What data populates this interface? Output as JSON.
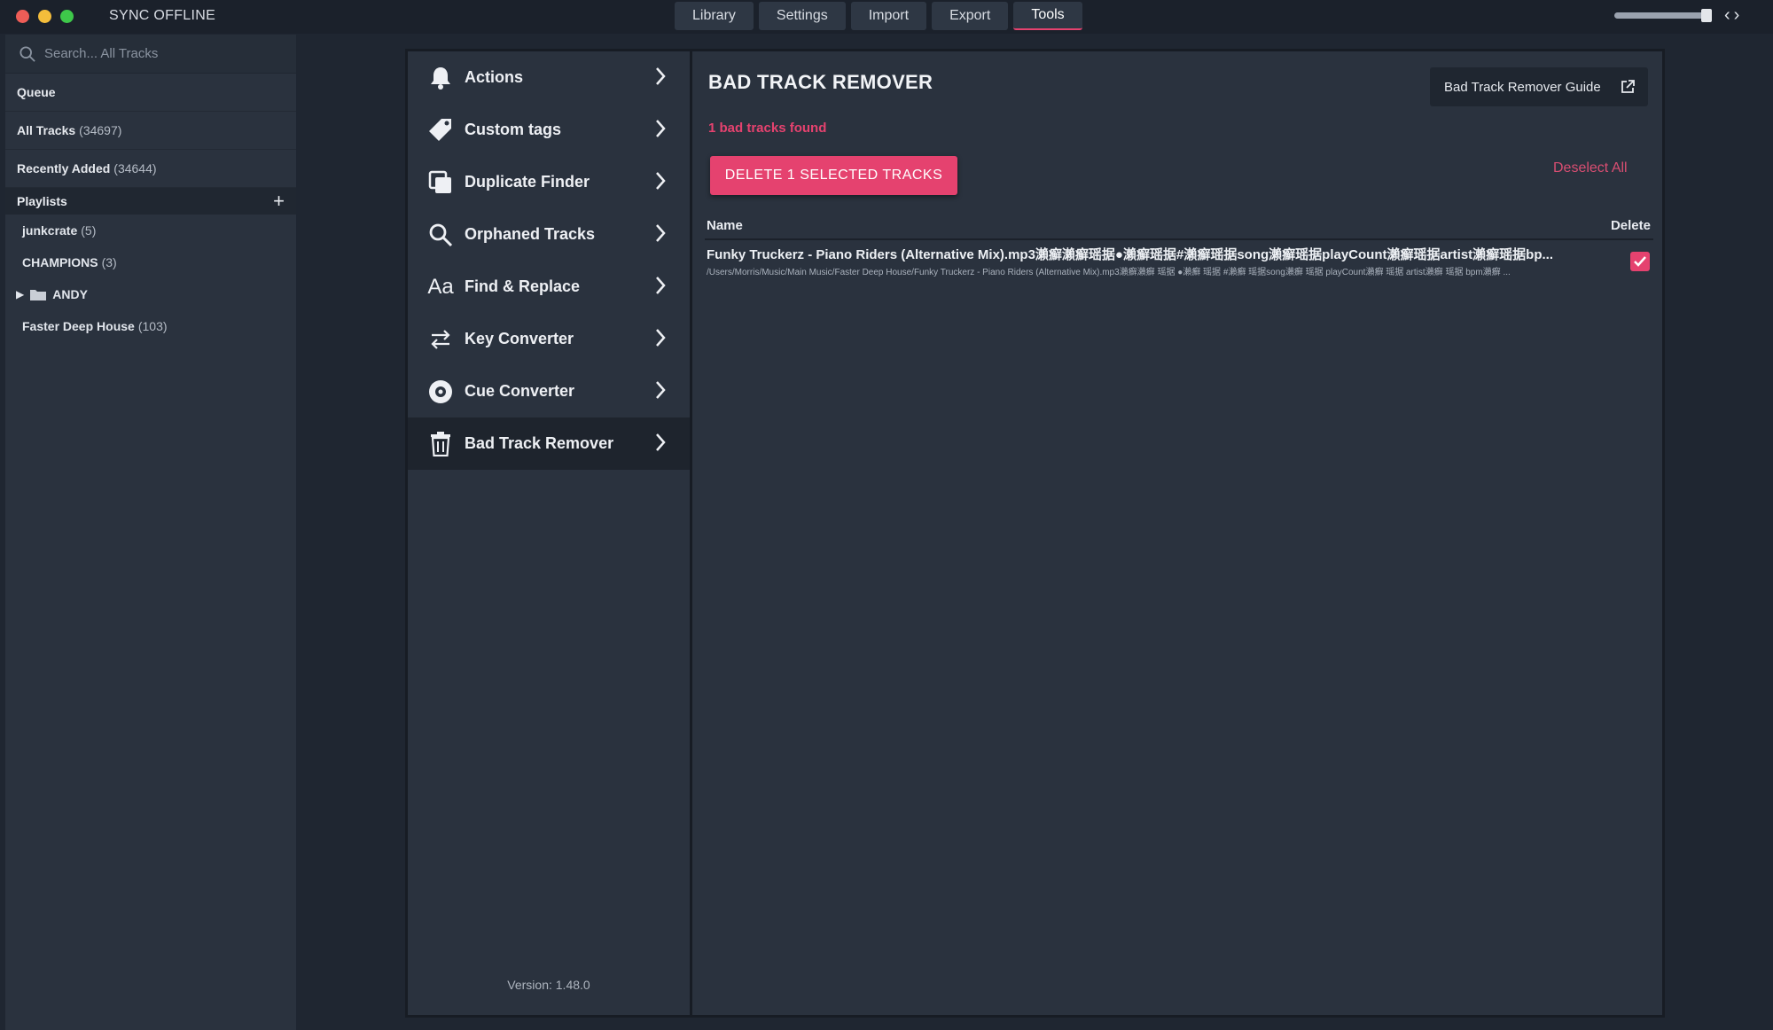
{
  "app": {
    "status": "SYNC OFFLINE"
  },
  "topnav": {
    "tabs": [
      {
        "label": "Library"
      },
      {
        "label": "Settings"
      },
      {
        "label": "Import"
      },
      {
        "label": "Export"
      },
      {
        "label": "Tools",
        "active": true
      }
    ]
  },
  "sidebar": {
    "search_placeholder": "Search... All Tracks",
    "items": [
      {
        "label": "Queue",
        "count": ""
      },
      {
        "label": "All Tracks",
        "count": "(34697)"
      },
      {
        "label": "Recently Added",
        "count": "(34644)"
      }
    ],
    "playlists_label": "Playlists",
    "playlists": [
      {
        "label": "junkcrate",
        "count": "(5)"
      },
      {
        "label": "CHAMPIONS",
        "count": "(3)"
      },
      {
        "label": "ANDY",
        "count": ""
      },
      {
        "label": "Faster Deep House",
        "count": "(103)"
      }
    ]
  },
  "tools": {
    "items": [
      {
        "label": "Actions",
        "icon": "bell-icon"
      },
      {
        "label": "Custom tags",
        "icon": "tag-icon"
      },
      {
        "label": "Duplicate Finder",
        "icon": "copy-icon"
      },
      {
        "label": "Orphaned Tracks",
        "icon": "search-icon"
      },
      {
        "label": "Find & Replace",
        "icon": "text-icon"
      },
      {
        "label": "Key Converter",
        "icon": "swap-arrows-icon"
      },
      {
        "label": "Cue Converter",
        "icon": "disc-icon"
      },
      {
        "label": "Bad Track Remover",
        "icon": "trash-icon",
        "active": true
      }
    ],
    "version": "Version: 1.48.0"
  },
  "content": {
    "title": "BAD TRACK REMOVER",
    "guide_label": "Bad Track Remover Guide",
    "found_text": "1 bad tracks found",
    "delete_label": "DELETE 1 SELECTED TRACKS",
    "deselect_label": "Deselect All",
    "col_name": "Name",
    "col_delete": "Delete",
    "rows": [
      {
        "title": "Funky Truckerz - Piano Riders (Alternative Mix).mp3瀨癬瀨癬瑶据●瀨癬瑶据#瀨癬瑶据song瀨癬瑶据playCount瀨癬瑶据artist瀨癬瑶据bp...",
        "path": "/Users/Morris/Music/Main Music/Faster Deep House/Funky Truckerz - Piano Riders (Alternative Mix).mp3瀨癬瀨癬 瑶据 ●瀨癬 瑶据 #瀨癬 瑶据song瀨癬 瑶据 playCount瀨癬 瑶据 artist瀨癬 瑶据 bpm瀨癬 ...",
        "checked": true
      }
    ]
  },
  "colors": {
    "accent": "#e5426f",
    "panel": "#2a323e",
    "background": "#1f2631"
  }
}
